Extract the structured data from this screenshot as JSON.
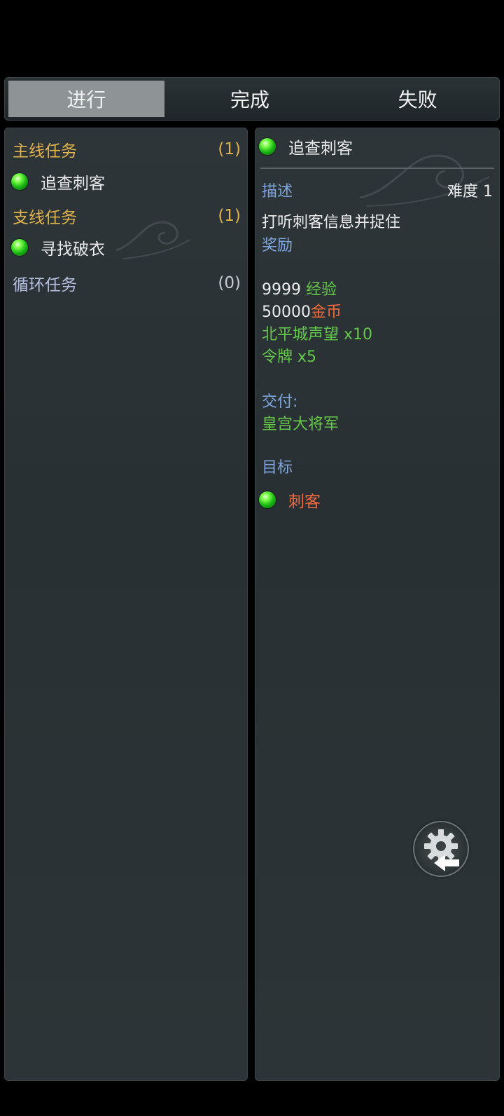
{
  "tabs": [
    {
      "label": "进行"
    },
    {
      "label": "完成"
    },
    {
      "label": "失败"
    }
  ],
  "quest_list": {
    "main": {
      "label": "主线任务",
      "count": "(1)"
    },
    "main_items": [
      {
        "label": "追查刺客"
      }
    ],
    "side": {
      "label": "支线任务",
      "count": "(1)"
    },
    "side_items": [
      {
        "label": "寻找破衣"
      }
    ],
    "loop": {
      "label": "循环任务",
      "count": "(0)"
    }
  },
  "detail": {
    "title": "追查刺客",
    "desc_label": "描述",
    "difficulty": "难度 1",
    "description": "打听刺客信息并捉住",
    "reward_label": "奖励",
    "rewards": {
      "exp_value": "9999",
      "exp_label": "经验",
      "gold_value": "50000",
      "gold_label": "金币",
      "reputation": "北平城声望 x10",
      "token": "令牌 x5"
    },
    "deliver_label": "交付:",
    "deliver_target": "皇宫大将军",
    "objective_label": "目标",
    "objective": "刺客"
  },
  "icons": {
    "orb": "green-orb-icon",
    "settings": "gear-back-icon"
  },
  "colors": {
    "category": "#e0b24c",
    "section_blue": "#7fa6e0",
    "reward_green": "#66c84a",
    "accent_orange": "#f0693b",
    "active_tab": "#8e9496"
  }
}
